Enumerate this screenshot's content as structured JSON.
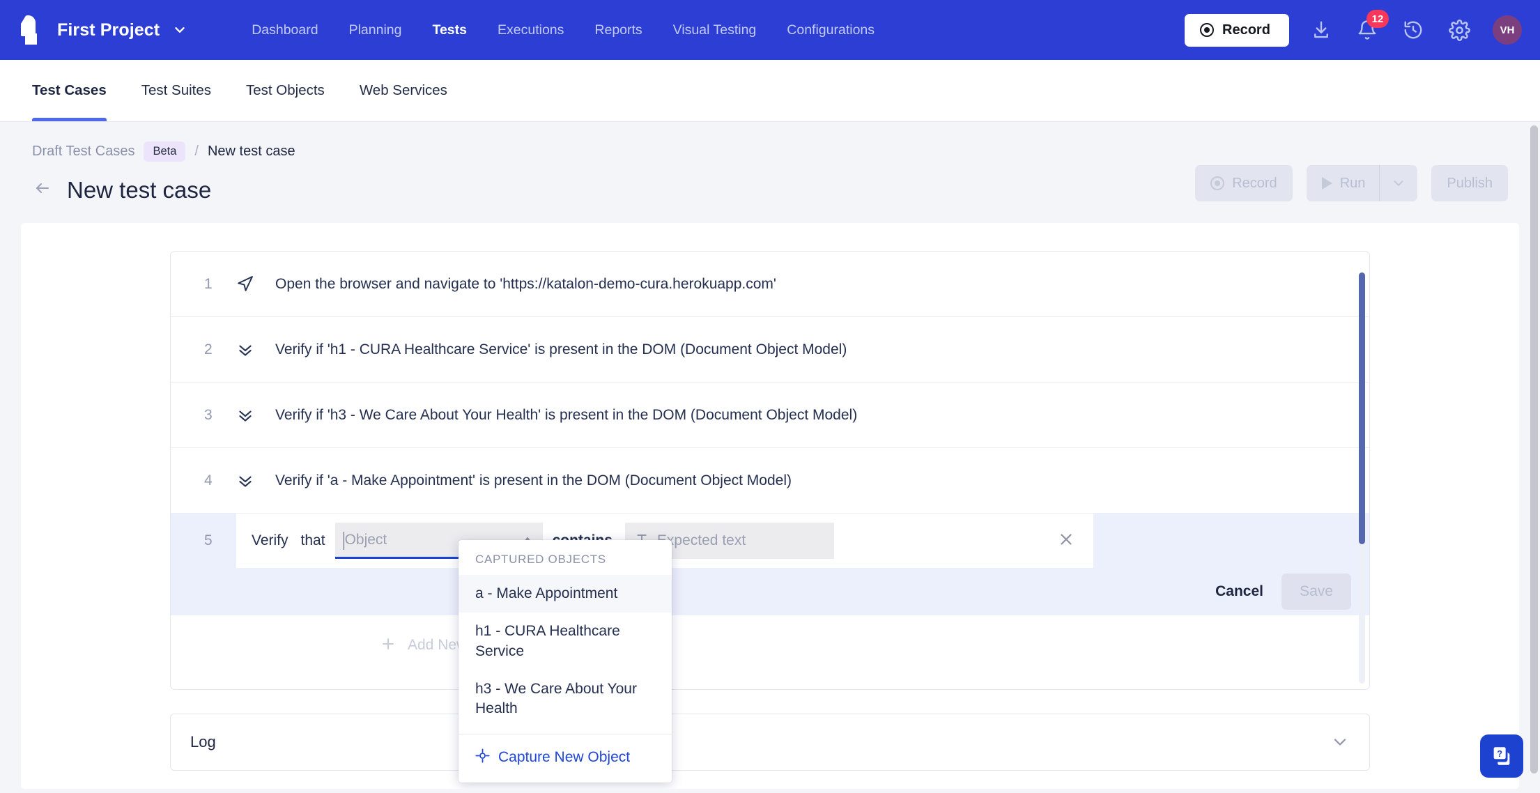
{
  "topnav": {
    "project_name": "First Project",
    "project_caret_icon": "chevron-down-icon",
    "logo_icon": "katalon-logo-icon",
    "links": [
      {
        "label": "Dashboard",
        "active": false
      },
      {
        "label": "Planning",
        "active": false
      },
      {
        "label": "Tests",
        "active": true
      },
      {
        "label": "Executions",
        "active": false
      },
      {
        "label": "Reports",
        "active": false
      },
      {
        "label": "Visual Testing",
        "active": false
      },
      {
        "label": "Configurations",
        "active": false
      }
    ],
    "record_label": "Record",
    "record_icon": "record-dot-icon",
    "download_icon": "download-icon",
    "notification_icon": "bell-icon",
    "notification_count": "12",
    "history_icon": "clock-history-icon",
    "settings_icon": "gear-icon",
    "avatar_initials": "VH"
  },
  "tabs": [
    {
      "label": "Test Cases",
      "active": true
    },
    {
      "label": "Test Suites",
      "active": false
    },
    {
      "label": "Test Objects",
      "active": false
    },
    {
      "label": "Web Services",
      "active": false
    }
  ],
  "breadcrumb": {
    "root": "Draft Test Cases",
    "beta_badge": "Beta",
    "separator": "/",
    "current": "New test case"
  },
  "header": {
    "back_icon": "back-arrow-icon",
    "title": "New test case",
    "actions": {
      "record_label": "Record",
      "run_label": "Run",
      "run_caret_icon": "chevron-down-icon",
      "publish_label": "Publish"
    }
  },
  "steps": [
    {
      "num": "1",
      "icon": "navigate-icon",
      "text": "Open the browser and navigate to 'https://katalon-demo-cura.herokuapp.com'"
    },
    {
      "num": "2",
      "icon": "verify-icon",
      "text": "Verify if 'h1 - CURA Healthcare Service' is present in the DOM (Document Object Model)"
    },
    {
      "num": "3",
      "icon": "verify-icon",
      "text": "Verify if 'h3 - We Care About Your Health' is present in the DOM (Document Object Model)"
    },
    {
      "num": "4",
      "icon": "verify-icon",
      "text": "Verify if 'a - Make Appointment' is present in the DOM (Document Object Model)"
    }
  ],
  "editing_step": {
    "num": "5",
    "keyword_verify": "Verify",
    "keyword_that": "that",
    "object_placeholder": "Object",
    "object_value": "",
    "object_caret_icon": "chevron-up-icon",
    "keyword_contains": "contains",
    "expected_icon": "text-format-icon",
    "expected_placeholder": "Expected text",
    "expected_value": "",
    "close_icon": "close-icon",
    "cancel_label": "Cancel",
    "save_label": "Save"
  },
  "dropdown": {
    "header": "CAPTURED OBJECTS",
    "items": [
      {
        "label": "a - Make Appointment",
        "highlighted": true
      },
      {
        "label": "h1 - CURA Healthcare Service",
        "highlighted": false
      },
      {
        "label": "h3 - We Care About Your Health",
        "highlighted": false
      }
    ],
    "capture_icon": "crosshair-icon",
    "capture_label": "Capture New Object"
  },
  "add_step": {
    "plus_icon": "plus-icon",
    "label": "Add New Test Step"
  },
  "log_panel": {
    "label": "Log",
    "caret_icon": "chevron-down-icon"
  },
  "help": {
    "icon": "help-question-icon"
  },
  "colors": {
    "nav_blue": "#2c3ed4",
    "accent_blue": "#1f46d8",
    "badge_red": "#f8385a",
    "avatar_purple": "#7b3f7f",
    "beta_lilac": "#ece4fb",
    "page_bg": "#f4f5f9",
    "row_highlight": "#eceffc"
  }
}
